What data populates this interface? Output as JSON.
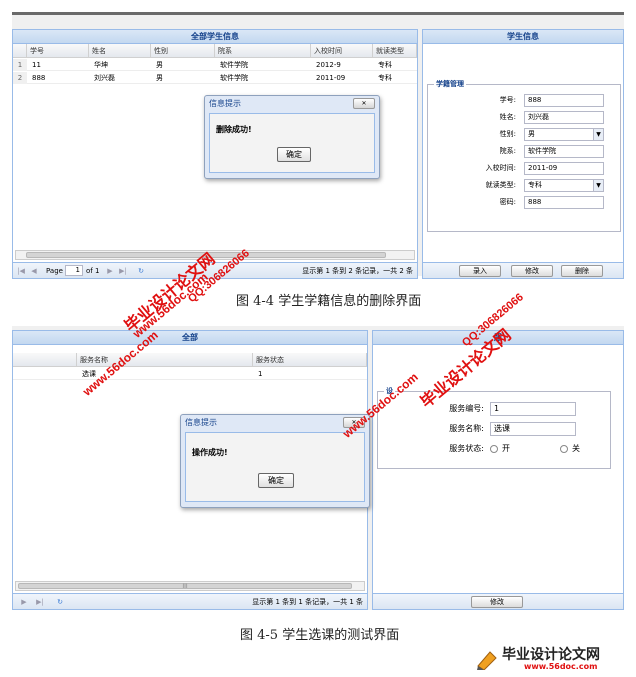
{
  "fig1": {
    "left_panel_title": "全部学生信息",
    "columns": [
      "学号",
      "姓名",
      "性别",
      "院系",
      "入校时间",
      "就读类型"
    ],
    "rows": [
      {
        "num": "1",
        "id": "11",
        "name": "华坤",
        "gender": "男",
        "dept": "软件学院",
        "enroll": "2012-9",
        "type": "专科"
      },
      {
        "num": "2",
        "id": "888",
        "name": "刘兴磊",
        "gender": "男",
        "dept": "软件学院",
        "enroll": "2011-09",
        "type": "专科"
      }
    ],
    "pager": {
      "page_label": "Page",
      "page_value": "1",
      "of_label": "of 1",
      "status": "显示第 1 条到 2 条记录，一共 2 条"
    },
    "dialog": {
      "title": "信息提示",
      "message": "删除成功!",
      "ok": "确定"
    },
    "right_panel_title": "学生信息",
    "fieldset_legend": "学籍管理",
    "fields": [
      {
        "label": "学号:",
        "value": "888"
      },
      {
        "label": "姓名:",
        "value": "刘兴磊"
      },
      {
        "label": "性别:",
        "value": "男"
      },
      {
        "label": "院系:",
        "value": "软件学院"
      },
      {
        "label": "入校时间:",
        "value": "2011-09"
      },
      {
        "label": "就读类型:",
        "value": "专科"
      },
      {
        "label": "密码:",
        "value": "888"
      }
    ],
    "buttons": [
      "录入",
      "修改",
      "删除"
    ],
    "caption": "图 4-4 学生学籍信息的删除界面"
  },
  "fig2": {
    "left_panel_title": "全部",
    "columns": [
      "服务名称",
      "服务状态"
    ],
    "rows": [
      {
        "name": "选课",
        "status": "1"
      }
    ],
    "pager": {
      "status": "显示第 1 条到 1 条记录，一共 1 条"
    },
    "scroll_label": "III",
    "dialog": {
      "title": "信息提示",
      "message": "操作成功!",
      "ok": "确定"
    },
    "right_panel_title": "服",
    "fieldset_legend": "设",
    "fields": [
      {
        "label": "服务编号:",
        "value": "1"
      },
      {
        "label": "服务名称:",
        "value": "选课"
      }
    ],
    "status_label": "服务状态:",
    "radio_on": "开",
    "radio_off": "关",
    "button": "修改",
    "caption": "图 4-5 学生选课的测试界面"
  },
  "watermarks": {
    "site_cn": "毕业设计论文网",
    "site_url": "www.56doc.com",
    "qq": "QQ:306826066"
  },
  "logo": {
    "text": "毕业设计论文网",
    "url": "www.56doc.com"
  },
  "colors": {
    "accent": "#15428b",
    "border": "#99bbe8",
    "watermark": "#e01010"
  }
}
